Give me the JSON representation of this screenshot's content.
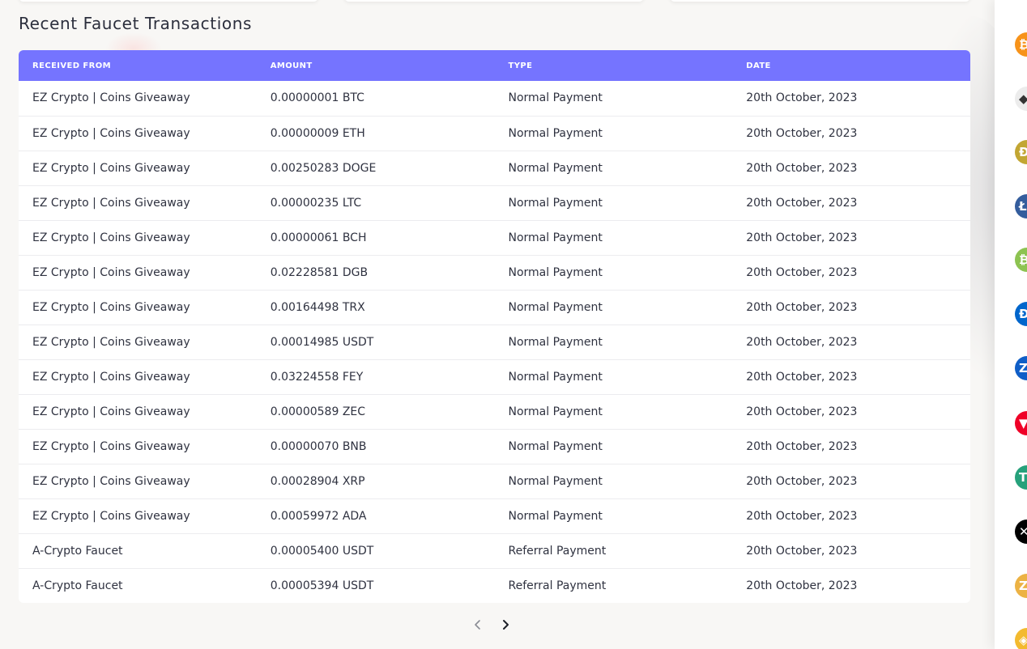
{
  "section_title": "Recent Faucet Transactions",
  "table": {
    "headers": [
      "RECEIVED FROM",
      "AMOUNT",
      "TYPE",
      "DATE"
    ],
    "rows": [
      [
        "EZ Crypto | Coins Giveaway",
        "0.00000001 BTC",
        "Normal Payment",
        "20th October, 2023"
      ],
      [
        "EZ Crypto | Coins Giveaway",
        "0.00000009 ETH",
        "Normal Payment",
        "20th October, 2023"
      ],
      [
        "EZ Crypto | Coins Giveaway",
        "0.00250283 DOGE",
        "Normal Payment",
        "20th October, 2023"
      ],
      [
        "EZ Crypto | Coins Giveaway",
        "0.00000235 LTC",
        "Normal Payment",
        "20th October, 2023"
      ],
      [
        "EZ Crypto | Coins Giveaway",
        "0.00000061 BCH",
        "Normal Payment",
        "20th October, 2023"
      ],
      [
        "EZ Crypto | Coins Giveaway",
        "0.02228581 DGB",
        "Normal Payment",
        "20th October, 2023"
      ],
      [
        "EZ Crypto | Coins Giveaway",
        "0.00164498 TRX",
        "Normal Payment",
        "20th October, 2023"
      ],
      [
        "EZ Crypto | Coins Giveaway",
        "0.00014985 USDT",
        "Normal Payment",
        "20th October, 2023"
      ],
      [
        "EZ Crypto | Coins Giveaway",
        "0.03224558 FEY",
        "Normal Payment",
        "20th October, 2023"
      ],
      [
        "EZ Crypto | Coins Giveaway",
        "0.00000589 ZEC",
        "Normal Payment",
        "20th October, 2023"
      ],
      [
        "EZ Crypto | Coins Giveaway",
        "0.00000070 BNB",
        "Normal Payment",
        "20th October, 2023"
      ],
      [
        "EZ Crypto | Coins Giveaway",
        "0.00028904 XRP",
        "Normal Payment",
        "20th October, 2023"
      ],
      [
        "EZ Crypto | Coins Giveaway",
        "0.00059972 ADA",
        "Normal Payment",
        "20th October, 2023"
      ],
      [
        "A-Crypto Faucet",
        "0.00005400 USDT",
        "Referral Payment",
        "20th October, 2023"
      ],
      [
        "A-Crypto Faucet",
        "0.00005394 USDT",
        "Referral Payment",
        "20th October, 2023"
      ]
    ]
  },
  "pagination": {
    "prev_icon": "chevron-left-icon",
    "next_icon": "chevron-right-icon"
  },
  "colors": {
    "header_bg": "#7574ff",
    "page_bg": "#f8f7f5"
  },
  "sidebar_coins": [
    {
      "icon": "bitcoin-icon",
      "color": "#f7931a",
      "glyph": "₿"
    },
    {
      "icon": "ethereum-icon",
      "color": "#ececec",
      "glyph": "◆"
    },
    {
      "icon": "dogecoin-icon",
      "color": "#c2a633",
      "glyph": "Ð"
    },
    {
      "icon": "litecoin-icon",
      "color": "#345d9d",
      "glyph": "Ł"
    },
    {
      "icon": "bitcoin-cash-icon",
      "color": "#8dc351",
      "glyph": "₿"
    },
    {
      "icon": "digibyte-icon",
      "color": "#0066cc",
      "glyph": "Ð"
    },
    {
      "icon": "zcash-icon",
      "color": "#0f5ec7",
      "glyph": "Z"
    },
    {
      "icon": "tron-icon",
      "color": "#ef0027",
      "glyph": "▼"
    },
    {
      "icon": "tether-icon",
      "color": "#26a17b",
      "glyph": "T"
    },
    {
      "icon": "xrp-icon",
      "color": "#000000",
      "glyph": "✕"
    },
    {
      "icon": "zec-gold-icon",
      "color": "#ecb244",
      "glyph": "Z"
    },
    {
      "icon": "bnb-icon",
      "color": "#f3ba2f",
      "glyph": "◈"
    }
  ]
}
